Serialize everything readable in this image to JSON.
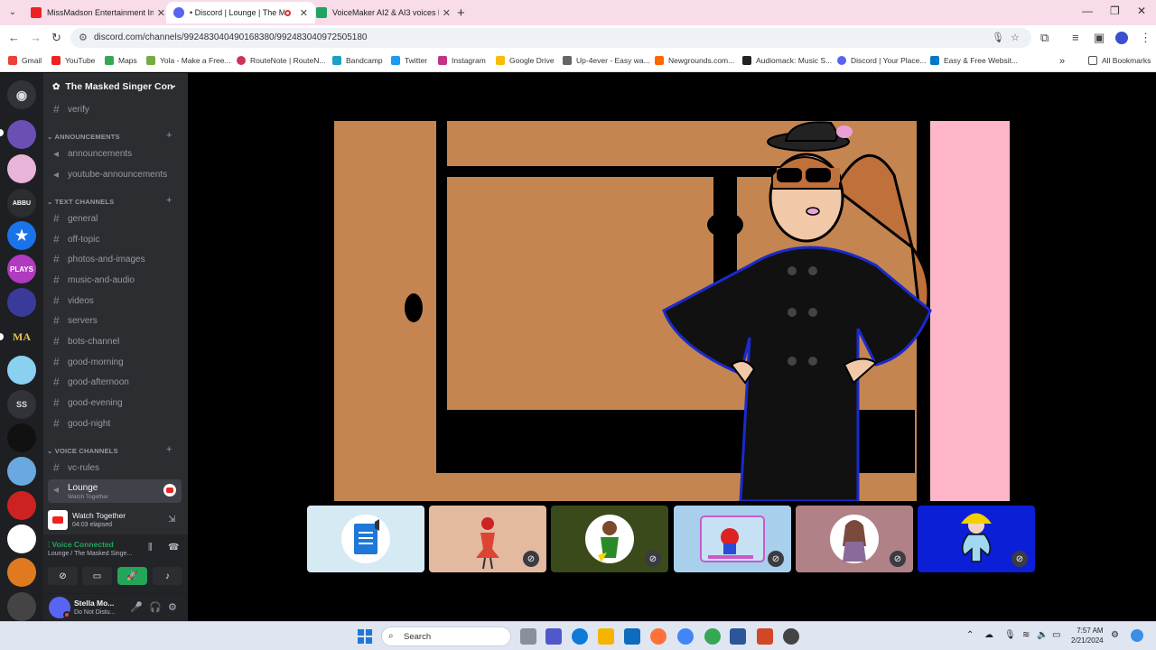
{
  "browser": {
    "tabs": [
      {
        "title": "MissMadson Entertainment Inc",
        "favicon_color": "#e22"
      },
      {
        "title": "• Discord | Lounge | The Ma",
        "favicon_color": "#5865f2"
      },
      {
        "title": "VoiceMaker AI2 & AI3 voices li",
        "favicon_color": "#1ea362"
      }
    ],
    "new_tab": "+",
    "url": "discord.com/channels/992483040490168380/992483040972505180",
    "bookmarks": [
      {
        "label": "Gmail",
        "color": "#ea4335"
      },
      {
        "label": "YouTube",
        "color": "#e22"
      },
      {
        "label": "Maps",
        "color": "#34a853"
      },
      {
        "label": "Yola - Make a Free...",
        "color": "#7a4"
      },
      {
        "label": "RouteNote | RouteN...",
        "color": "#c35"
      },
      {
        "label": "Bandcamp",
        "color": "#1da0c3"
      },
      {
        "label": "Twitter",
        "color": "#1d9bf0"
      },
      {
        "label": "Instagram",
        "color": "#c13584"
      },
      {
        "label": "Google Drive",
        "color": "#fbbc04"
      },
      {
        "label": "Up-4ever - Easy wa...",
        "color": "#666"
      },
      {
        "label": "Newgrounds.com...",
        "color": "#f60"
      },
      {
        "label": "Audiomack: Music S...",
        "color": "#222"
      },
      {
        "label": "Discord | Your Place...",
        "color": "#5865f2"
      },
      {
        "label": "Easy & Free Websit...",
        "color": "#0077c8"
      }
    ],
    "all_bookmarks": "All Bookmarks"
  },
  "discord": {
    "servers": [
      {
        "label": "",
        "color": "#5865f2"
      },
      {
        "label": "",
        "color": "#6a4fb5"
      },
      {
        "label": "",
        "color": "#e8b4d8"
      },
      {
        "label": "ABBU",
        "color": "#2b2d31"
      },
      {
        "label": "★",
        "color": "#1a73e8"
      },
      {
        "label": "PLAYS",
        "color": "#b03ac0"
      },
      {
        "label": "",
        "color": "#3a3a9a"
      },
      {
        "label": "MA",
        "color": "#1e1f22"
      },
      {
        "label": "",
        "color": "#8ad0f0"
      },
      {
        "label": "SS",
        "color": "#313338"
      },
      {
        "label": "",
        "color": "#111"
      },
      {
        "label": "",
        "color": "#6aa8e0"
      },
      {
        "label": "",
        "color": "#c22"
      },
      {
        "label": "",
        "color": "#fff"
      },
      {
        "label": "",
        "color": "#e07a20"
      },
      {
        "label": "",
        "color": "#444"
      }
    ],
    "guild_name": "The Masked Singer Con",
    "top_channel": "verify",
    "categories": {
      "announcements": "ANNOUNCEMENTS",
      "text": "TEXT CHANNELS",
      "voice": "VOICE CHANNELS"
    },
    "announcement_channels": [
      "announcements",
      "youtube-announcements"
    ],
    "text_channels": [
      "general",
      "off-topic",
      "photos-and-images",
      "music-and-audio",
      "videos",
      "servers",
      "bots-channel",
      "good-morning",
      "good-afternoon",
      "good-evening",
      "good-night"
    ],
    "voice_channels": [
      {
        "name": "vc-rules"
      },
      {
        "name": "Lounge",
        "sub": "Watch Together"
      }
    ],
    "activity": {
      "title": "Watch Together",
      "elapsed": "04:03 elapsed"
    },
    "voice_panel": {
      "status": "Voice Connected",
      "location": "Lounge / The Masked Singe..."
    },
    "user": {
      "name": "Stella Mo...",
      "status": "Do Not Distu..."
    }
  },
  "taskbar": {
    "search_label": "Search",
    "time": "7:57 AM",
    "date": "2/21/2024",
    "apps": [
      "#8a8f99",
      "#5059c9",
      "#0f7bd8",
      "#f4b400",
      "#0f6cbd",
      "#ff7139",
      "#4285f4",
      "#34a853",
      "#2b579a",
      "#d24726",
      "#444"
    ]
  }
}
